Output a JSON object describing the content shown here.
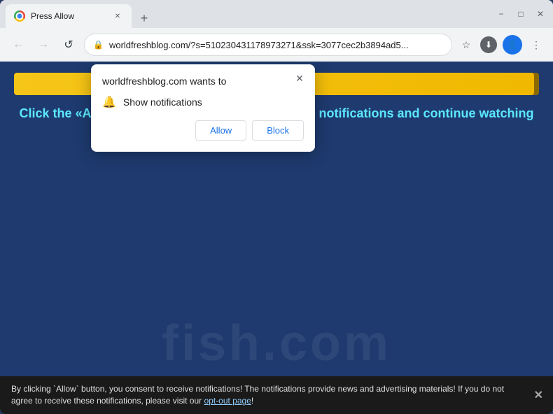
{
  "browser": {
    "tab": {
      "title": "Press Allow",
      "favicon_label": "chrome-favicon"
    },
    "address_bar": {
      "url": "worldfreshblog.com/?s=510230431178973271&ssk=3077cec2b3894ad5...",
      "lock_symbol": "🔒"
    },
    "nav": {
      "back_arrow": "←",
      "forward_arrow": "→",
      "reload": "↺"
    },
    "window_controls": {
      "minimize": "−",
      "maximize": "□",
      "close": "✕"
    },
    "new_tab_btn": "+",
    "tab_close": "✕"
  },
  "notification_popup": {
    "title": "worldfreshblog.com wants to",
    "permission_label": "Show notifications",
    "allow_label": "Allow",
    "block_label": "Block",
    "close_symbol": "✕"
  },
  "page": {
    "progress_percent": "99%",
    "cta_text": "Click the «Allow» button to subscribe to the push notifications and continue watching",
    "watermark": "fish.com"
  },
  "consent_bar": {
    "text": "By clicking `Allow` button, you consent to receive notifications! The notifications provide news and advertising materials! If you do not agree to receive these notifications, please visit our ",
    "link_text": "opt-out page",
    "text_suffix": "!",
    "close_symbol": "✕"
  },
  "icons": {
    "bell": "🔔",
    "lock": "🔒",
    "star": "☆",
    "menu": "⋮",
    "download": "⬇"
  }
}
